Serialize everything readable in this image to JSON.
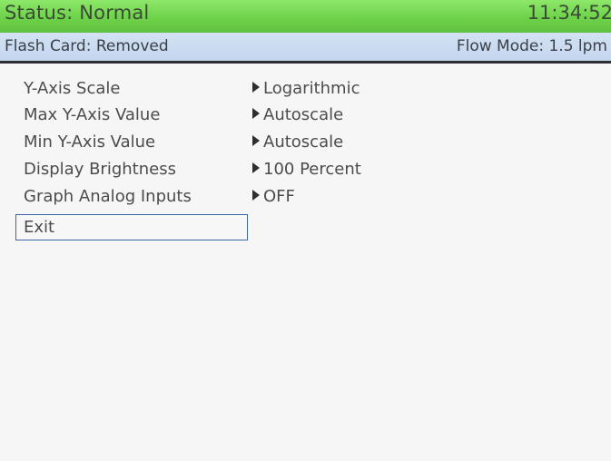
{
  "status_bar": {
    "status_text": "Status: Normal",
    "time": "11:34:52",
    "color": "#74d650"
  },
  "info_bar": {
    "flash_card": "Flash Card: Removed",
    "flow_mode": "Flow Mode: 1.5 lpm",
    "color": "#c8daf0"
  },
  "menu": {
    "items": [
      {
        "label": "Y-Axis Scale",
        "value": "Logarithmic"
      },
      {
        "label": "Max Y-Axis Value",
        "value": "Autoscale"
      },
      {
        "label": "Min Y-Axis Value",
        "value": "Autoscale"
      },
      {
        "label": "Display Brightness",
        "value": "100 Percent"
      },
      {
        "label": "Graph Analog Inputs",
        "value": "OFF"
      }
    ],
    "exit_label": "Exit",
    "selection_color": "#3f64a8"
  },
  "icons": {
    "value_arrow": "triangle-right-icon"
  }
}
